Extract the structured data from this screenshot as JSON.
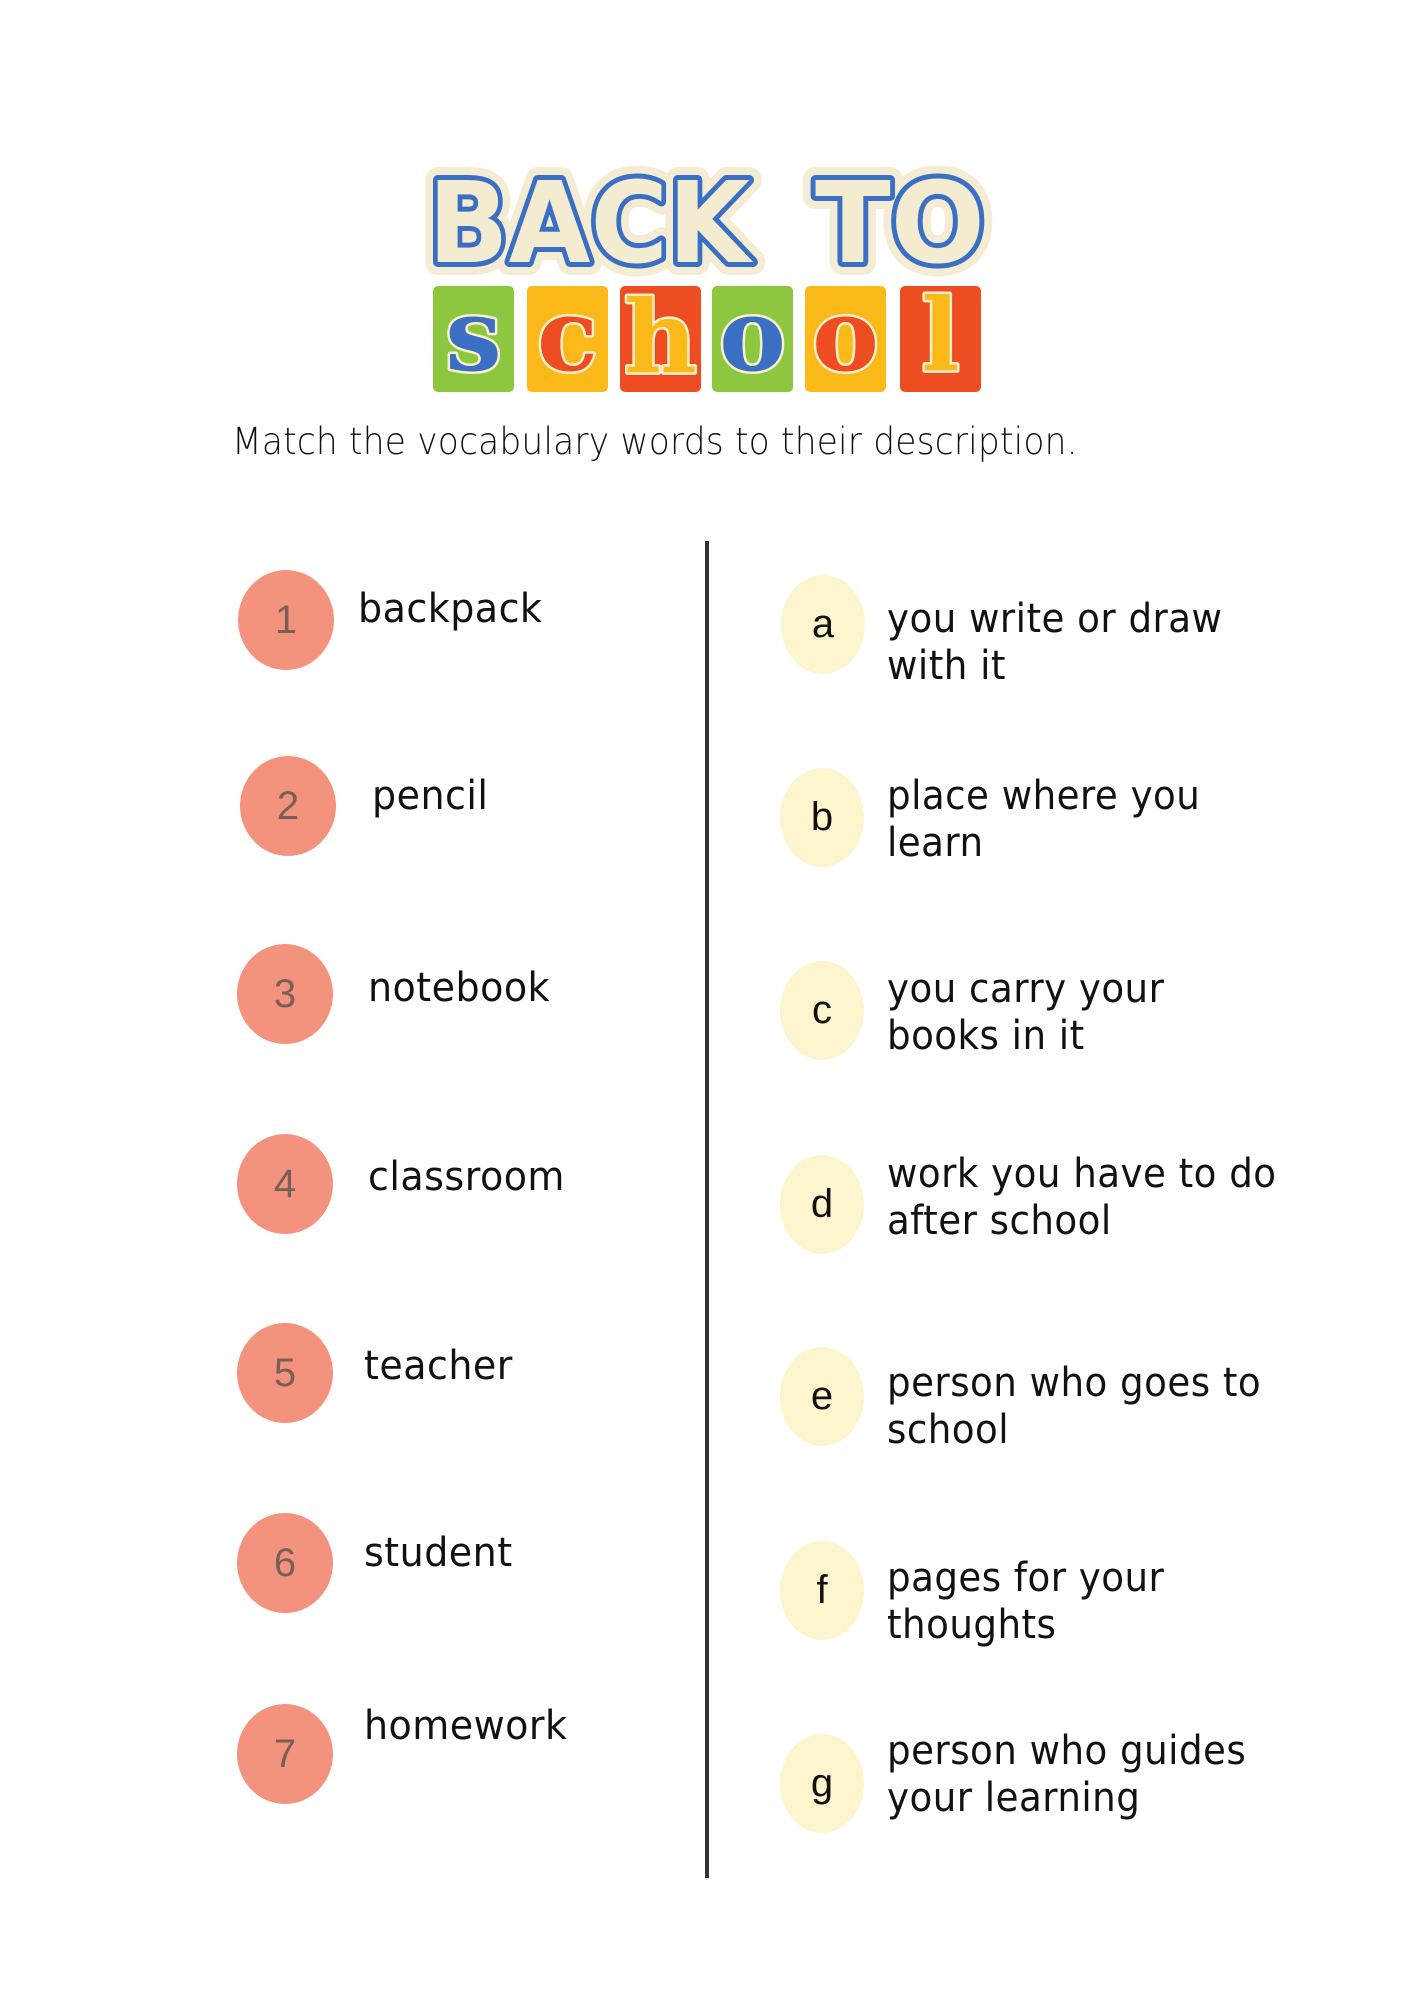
{
  "logo": {
    "line1": [
      "BACK",
      "TO"
    ],
    "line2_letters": [
      {
        "char": "s",
        "tile_color": "#8DC63F",
        "letter_color": "#3A6FC4"
      },
      {
        "char": "c",
        "tile_color": "#FBB91A",
        "letter_color": "#EE4D21"
      },
      {
        "char": "h",
        "tile_color": "#EE4D21",
        "letter_color": "#FBB91A"
      },
      {
        "char": "o",
        "tile_color": "#8DC63F",
        "letter_color": "#3A6FC4"
      },
      {
        "char": "o",
        "tile_color": "#FBB91A",
        "letter_color": "#EE4D21"
      },
      {
        "char": "l",
        "tile_color": "#EE4D21",
        "letter_color": "#FBB91A"
      }
    ],
    "colors": {
      "blue": "#3A6FC4",
      "cream": "#F3ECD0"
    }
  },
  "instruction": "Match the vocabulary words to their description.",
  "words": [
    {
      "number": "1",
      "text": "backpack"
    },
    {
      "number": "2",
      "text": "pencil"
    },
    {
      "number": "3",
      "text": "notebook"
    },
    {
      "number": "4",
      "text": "classroom"
    },
    {
      "number": "5",
      "text": "teacher"
    },
    {
      "number": "6",
      "text": "student"
    },
    {
      "number": "7",
      "text": "homework"
    }
  ],
  "descriptions": [
    {
      "letter": "a",
      "lines": [
        "you write or draw",
        "with it"
      ]
    },
    {
      "letter": "b",
      "lines": [
        "place where you",
        "learn"
      ]
    },
    {
      "letter": "c",
      "lines": [
        "you carry your",
        "books in it"
      ]
    },
    {
      "letter": "d",
      "lines": [
        "work you have to do",
        "after school"
      ]
    },
    {
      "letter": "e",
      "lines": [
        "person who goes to",
        "school"
      ]
    },
    {
      "letter": "f",
      "lines": [
        "pages for your",
        "thoughts"
      ]
    },
    {
      "letter": "g",
      "lines": [
        "person who guides",
        "your learning"
      ]
    }
  ],
  "colors": {
    "number_circle": "#F4937D",
    "letter_circle": "#FDF5CE",
    "divider": "#333333"
  }
}
